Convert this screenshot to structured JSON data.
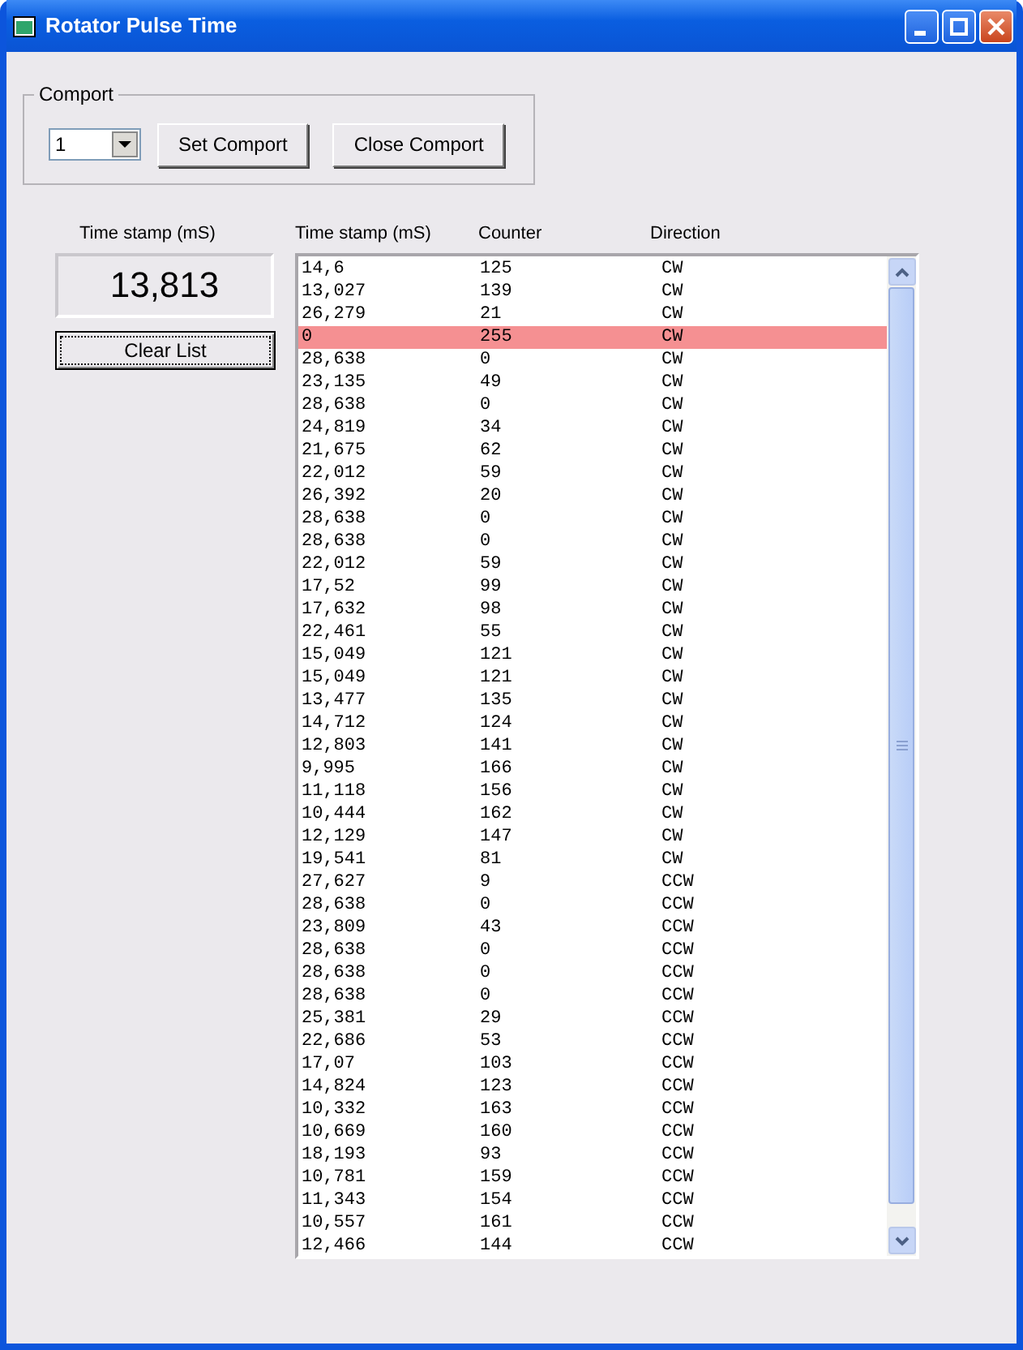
{
  "window": {
    "title": "Rotator Pulse Time"
  },
  "comport": {
    "label": "Comport",
    "port": "1",
    "buttons": [
      "Set Comport",
      "Close Comport"
    ]
  },
  "current": {
    "label": "Time stamp (mS)",
    "value": "13,813",
    "clear_button": "Clear List"
  },
  "list": {
    "columns": [
      "Time stamp (mS)",
      "Counter",
      "Direction"
    ],
    "rows": [
      {
        "time": "14,6",
        "counter": "125",
        "direction": "CW",
        "selected": false
      },
      {
        "time": "13,027",
        "counter": "139",
        "direction": "CW",
        "selected": false
      },
      {
        "time": "26,279",
        "counter": "21",
        "direction": "CW",
        "selected": false
      },
      {
        "time": "0",
        "counter": "255",
        "direction": "CW",
        "selected": true
      },
      {
        "time": "28,638",
        "counter": "0",
        "direction": "CW",
        "selected": false
      },
      {
        "time": "23,135",
        "counter": "49",
        "direction": "CW",
        "selected": false
      },
      {
        "time": "28,638",
        "counter": "0",
        "direction": "CW",
        "selected": false
      },
      {
        "time": "24,819",
        "counter": "34",
        "direction": "CW",
        "selected": false
      },
      {
        "time": "21,675",
        "counter": "62",
        "direction": "CW",
        "selected": false
      },
      {
        "time": "22,012",
        "counter": "59",
        "direction": "CW",
        "selected": false
      },
      {
        "time": "26,392",
        "counter": "20",
        "direction": "CW",
        "selected": false
      },
      {
        "time": "28,638",
        "counter": "0",
        "direction": "CW",
        "selected": false
      },
      {
        "time": "28,638",
        "counter": "0",
        "direction": "CW",
        "selected": false
      },
      {
        "time": "22,012",
        "counter": "59",
        "direction": "CW",
        "selected": false
      },
      {
        "time": "17,52",
        "counter": "99",
        "direction": "CW",
        "selected": false
      },
      {
        "time": "17,632",
        "counter": "98",
        "direction": "CW",
        "selected": false
      },
      {
        "time": "22,461",
        "counter": "55",
        "direction": "CW",
        "selected": false
      },
      {
        "time": "15,049",
        "counter": "121",
        "direction": "CW",
        "selected": false
      },
      {
        "time": "15,049",
        "counter": "121",
        "direction": "CW",
        "selected": false
      },
      {
        "time": "13,477",
        "counter": "135",
        "direction": "CW",
        "selected": false
      },
      {
        "time": "14,712",
        "counter": "124",
        "direction": "CW",
        "selected": false
      },
      {
        "time": "12,803",
        "counter": "141",
        "direction": "CW",
        "selected": false
      },
      {
        "time": "9,995",
        "counter": "166",
        "direction": "CW",
        "selected": false
      },
      {
        "time": "11,118",
        "counter": "156",
        "direction": "CW",
        "selected": false
      },
      {
        "time": "10,444",
        "counter": "162",
        "direction": "CW",
        "selected": false
      },
      {
        "time": "12,129",
        "counter": "147",
        "direction": "CW",
        "selected": false
      },
      {
        "time": "19,541",
        "counter": "81",
        "direction": "CW",
        "selected": false
      },
      {
        "time": "27,627",
        "counter": "9",
        "direction": "CCW",
        "selected": false
      },
      {
        "time": "28,638",
        "counter": "0",
        "direction": "CCW",
        "selected": false
      },
      {
        "time": "23,809",
        "counter": "43",
        "direction": "CCW",
        "selected": false
      },
      {
        "time": "28,638",
        "counter": "0",
        "direction": "CCW",
        "selected": false
      },
      {
        "time": "28,638",
        "counter": "0",
        "direction": "CCW",
        "selected": false
      },
      {
        "time": "28,638",
        "counter": "0",
        "direction": "CCW",
        "selected": false
      },
      {
        "time": "25,381",
        "counter": "29",
        "direction": "CCW",
        "selected": false
      },
      {
        "time": "22,686",
        "counter": "53",
        "direction": "CCW",
        "selected": false
      },
      {
        "time": "17,07",
        "counter": "103",
        "direction": "CCW",
        "selected": false
      },
      {
        "time": "14,824",
        "counter": "123",
        "direction": "CCW",
        "selected": false
      },
      {
        "time": "10,332",
        "counter": "163",
        "direction": "CCW",
        "selected": false
      },
      {
        "time": "10,669",
        "counter": "160",
        "direction": "CCW",
        "selected": false
      },
      {
        "time": "18,193",
        "counter": "93",
        "direction": "CCW",
        "selected": false
      },
      {
        "time": "10,781",
        "counter": "159",
        "direction": "CCW",
        "selected": false
      },
      {
        "time": "11,343",
        "counter": "154",
        "direction": "CCW",
        "selected": false
      },
      {
        "time": "10,557",
        "counter": "161",
        "direction": "CCW",
        "selected": false
      },
      {
        "time": "12,466",
        "counter": "144",
        "direction": "CCW",
        "selected": false
      }
    ]
  }
}
